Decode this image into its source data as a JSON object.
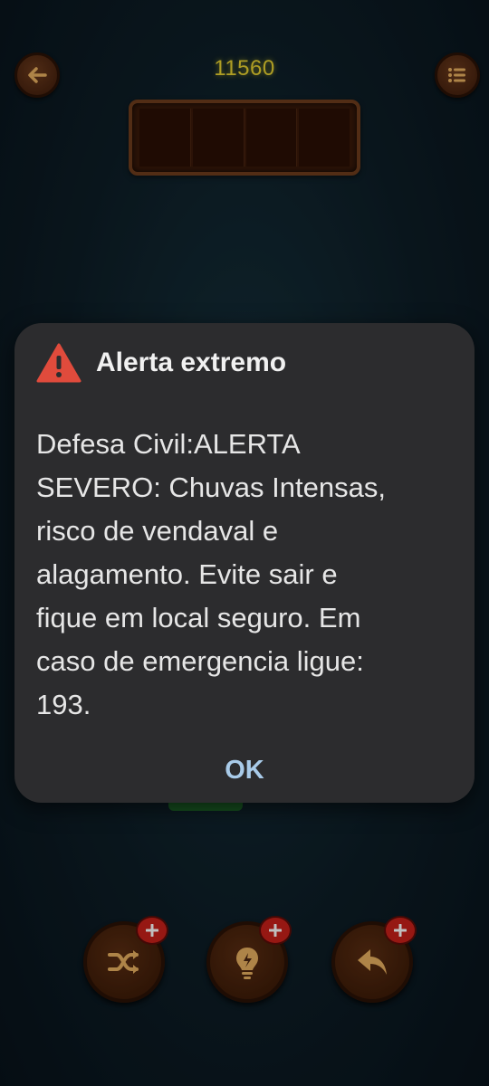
{
  "game": {
    "score": "11560",
    "icons": {
      "back": "arrow-left-icon",
      "menu": "list-menu-icon",
      "shuffle": "shuffle-icon",
      "hint": "lightbulb-icon",
      "undo": "undo-icon",
      "plus": "plus-icon"
    },
    "answer_slot_count": 4
  },
  "alert": {
    "title": "Alerta extremo",
    "icon": "warning-triangle-icon",
    "body": "Defesa Civil:ALERTA\nSEVERO: Chuvas Intensas,\nrisco de vendaval e\nalagamento. Evite sair e\nfique em local seguro. Em\ncaso de emergencia ligue:\n193.",
    "ok_label": "OK",
    "colors": {
      "warning": "#e04b3c",
      "button_text": "#a9cbe9",
      "background": "#2c2c2e"
    }
  }
}
